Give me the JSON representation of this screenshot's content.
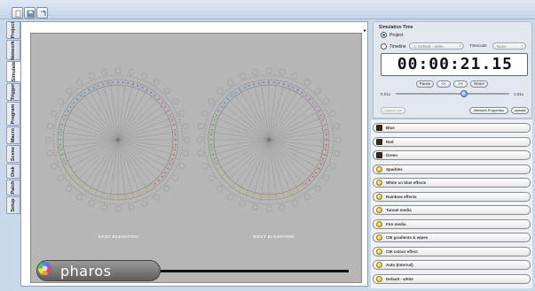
{
  "toolbar": {
    "buttons": [
      {
        "name": "new-document-icon"
      },
      {
        "name": "save-icon"
      },
      {
        "name": "refresh-icon"
      }
    ]
  },
  "tabs": [
    {
      "label": "Setup"
    },
    {
      "label": "Patch"
    },
    {
      "label": "Disk"
    },
    {
      "label": "Scene"
    },
    {
      "label": "Macro"
    },
    {
      "label": "Program"
    },
    {
      "label": "Trigger"
    },
    {
      "label": "Simulate",
      "active": true
    },
    {
      "label": "Network"
    },
    {
      "label": "Project"
    }
  ],
  "canvas": {
    "east_label": "EAST ELEVATION",
    "west_label": "WEST ELEVATION",
    "logo_text": "pharos"
  },
  "simulation": {
    "title": "Simulation Time",
    "project_label": "Project",
    "timeline_label": "Timeline",
    "timeline_value": "1: Default - white",
    "timecode_label": "Timecode",
    "timecode_value": "None",
    "time_display": "00:00:21.15",
    "buttons": {
      "pause": "Pause",
      "back": "<<",
      "forward": ">>",
      "reset": "Reset"
    },
    "rate_min": "0.01x",
    "rate_max": "1.01x",
    "rate_fraction": 0.6,
    "actions": {
      "output_live": "Output Live",
      "network_properties": "Network Properties",
      "upload": "Upload"
    }
  },
  "list_items": [
    {
      "label": "Blue",
      "icon": "scene-swatch-icon"
    },
    {
      "label": "Red",
      "icon": "scene-swatch-icon"
    },
    {
      "label": "Green",
      "icon": "scene-swatch-icon"
    },
    {
      "label": "Sparkles",
      "icon": "timeline-clock-icon"
    },
    {
      "label": "White on blue effects",
      "icon": "timeline-clock-icon"
    },
    {
      "label": "Rainbow effects",
      "icon": "timeline-clock-icon"
    },
    {
      "label": "Tunnel media",
      "icon": "timeline-clock-icon"
    },
    {
      "label": "Fire media",
      "icon": "timeline-clock-icon"
    },
    {
      "label": "CIE gradients & wipes",
      "icon": "timeline-clock-icon"
    },
    {
      "label": "CIE colour effect",
      "icon": "timeline-clock-icon"
    },
    {
      "label": "Auto (Internal)",
      "icon": "timeline-clock-icon"
    },
    {
      "label": "Default - white",
      "icon": "timeline-clock-icon"
    }
  ],
  "colors": {
    "accent": "#2a6fd6",
    "canvas_bg": "#b6b6b6",
    "window_bg": "#c9d9ea"
  }
}
